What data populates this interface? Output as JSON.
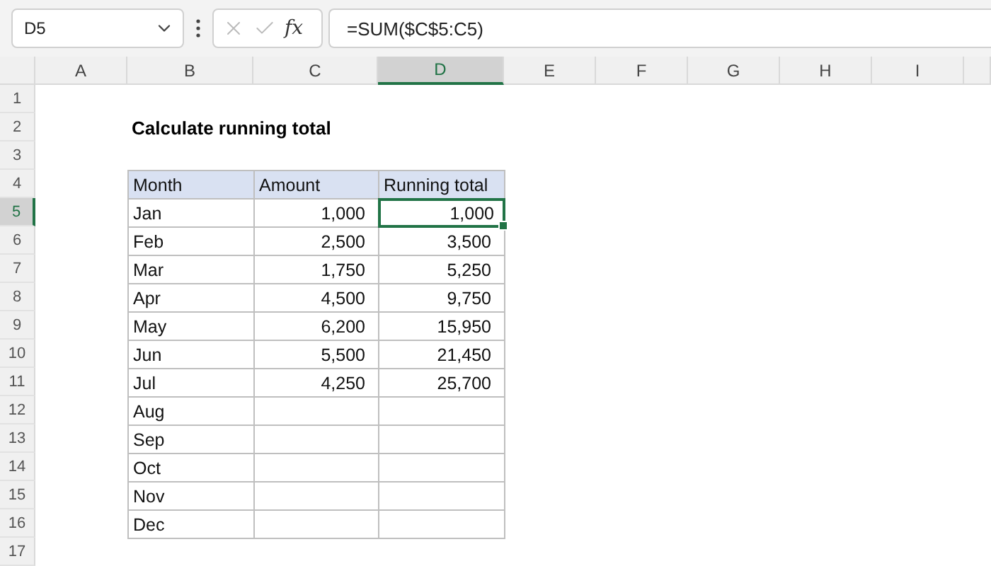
{
  "name_box": "D5",
  "function_button": "fx",
  "formula": "=SUM($C$5:C5)",
  "columns": [
    {
      "label": "A",
      "selected": false
    },
    {
      "label": "B",
      "selected": false
    },
    {
      "label": "C",
      "selected": false
    },
    {
      "label": "D",
      "selected": true
    },
    {
      "label": "E",
      "selected": false
    },
    {
      "label": "F",
      "selected": false
    },
    {
      "label": "G",
      "selected": false
    },
    {
      "label": "H",
      "selected": false
    },
    {
      "label": "I",
      "selected": false
    }
  ],
  "rows": [
    {
      "label": "1",
      "selected": false
    },
    {
      "label": "2",
      "selected": false
    },
    {
      "label": "3",
      "selected": false
    },
    {
      "label": "4",
      "selected": false
    },
    {
      "label": "5",
      "selected": true
    },
    {
      "label": "6",
      "selected": false
    },
    {
      "label": "7",
      "selected": false
    },
    {
      "label": "8",
      "selected": false
    },
    {
      "label": "9",
      "selected": false
    },
    {
      "label": "10",
      "selected": false
    },
    {
      "label": "11",
      "selected": false
    },
    {
      "label": "12",
      "selected": false
    },
    {
      "label": "13",
      "selected": false
    },
    {
      "label": "14",
      "selected": false
    },
    {
      "label": "15",
      "selected": false
    },
    {
      "label": "16",
      "selected": false
    },
    {
      "label": "17",
      "selected": false
    }
  ],
  "title": "Calculate running total",
  "table": {
    "headers": [
      "Month",
      "Amount",
      "Running total"
    ],
    "rows": [
      {
        "cells": [
          {
            "text": "Jan",
            "selected": false
          },
          {
            "text": "1,000",
            "selected": false
          },
          {
            "text": "1,000",
            "selected": true
          }
        ]
      },
      {
        "cells": [
          {
            "text": "Feb",
            "selected": false
          },
          {
            "text": "2,500",
            "selected": false
          },
          {
            "text": "3,500",
            "selected": false
          }
        ]
      },
      {
        "cells": [
          {
            "text": "Mar",
            "selected": false
          },
          {
            "text": "1,750",
            "selected": false
          },
          {
            "text": "5,250",
            "selected": false
          }
        ]
      },
      {
        "cells": [
          {
            "text": "Apr",
            "selected": false
          },
          {
            "text": "4,500",
            "selected": false
          },
          {
            "text": "9,750",
            "selected": false
          }
        ]
      },
      {
        "cells": [
          {
            "text": "May",
            "selected": false
          },
          {
            "text": "6,200",
            "selected": false
          },
          {
            "text": "15,950",
            "selected": false
          }
        ]
      },
      {
        "cells": [
          {
            "text": "Jun",
            "selected": false
          },
          {
            "text": "5,500",
            "selected": false
          },
          {
            "text": "21,450",
            "selected": false
          }
        ]
      },
      {
        "cells": [
          {
            "text": "Jul",
            "selected": false
          },
          {
            "text": "4,250",
            "selected": false
          },
          {
            "text": "25,700",
            "selected": false
          }
        ]
      },
      {
        "cells": [
          {
            "text": "Aug",
            "selected": false
          }
        ]
      },
      {
        "cells": [
          {
            "text": "Sep",
            "selected": false
          }
        ]
      },
      {
        "cells": [
          {
            "text": "Oct",
            "selected": false
          }
        ]
      },
      {
        "cells": [
          {
            "text": "Nov",
            "selected": false
          }
        ]
      },
      {
        "cells": [
          {
            "text": "Dec",
            "selected": false
          }
        ]
      }
    ]
  }
}
